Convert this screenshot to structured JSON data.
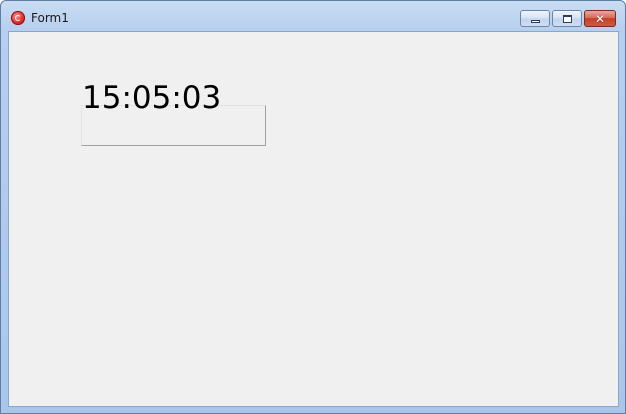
{
  "window": {
    "title": "Form1",
    "app_icon": "delphi-app-icon",
    "caption_buttons": {
      "minimize": "minimize-icon",
      "maximize": "maximize-icon",
      "close": "close-icon"
    }
  },
  "form": {
    "clock_text": "15:05:03"
  },
  "colors": {
    "client_background": "#f0f0f0",
    "titlebar": "#b6cfee",
    "close_button": "#c2412a",
    "clock_text": "#000000"
  }
}
